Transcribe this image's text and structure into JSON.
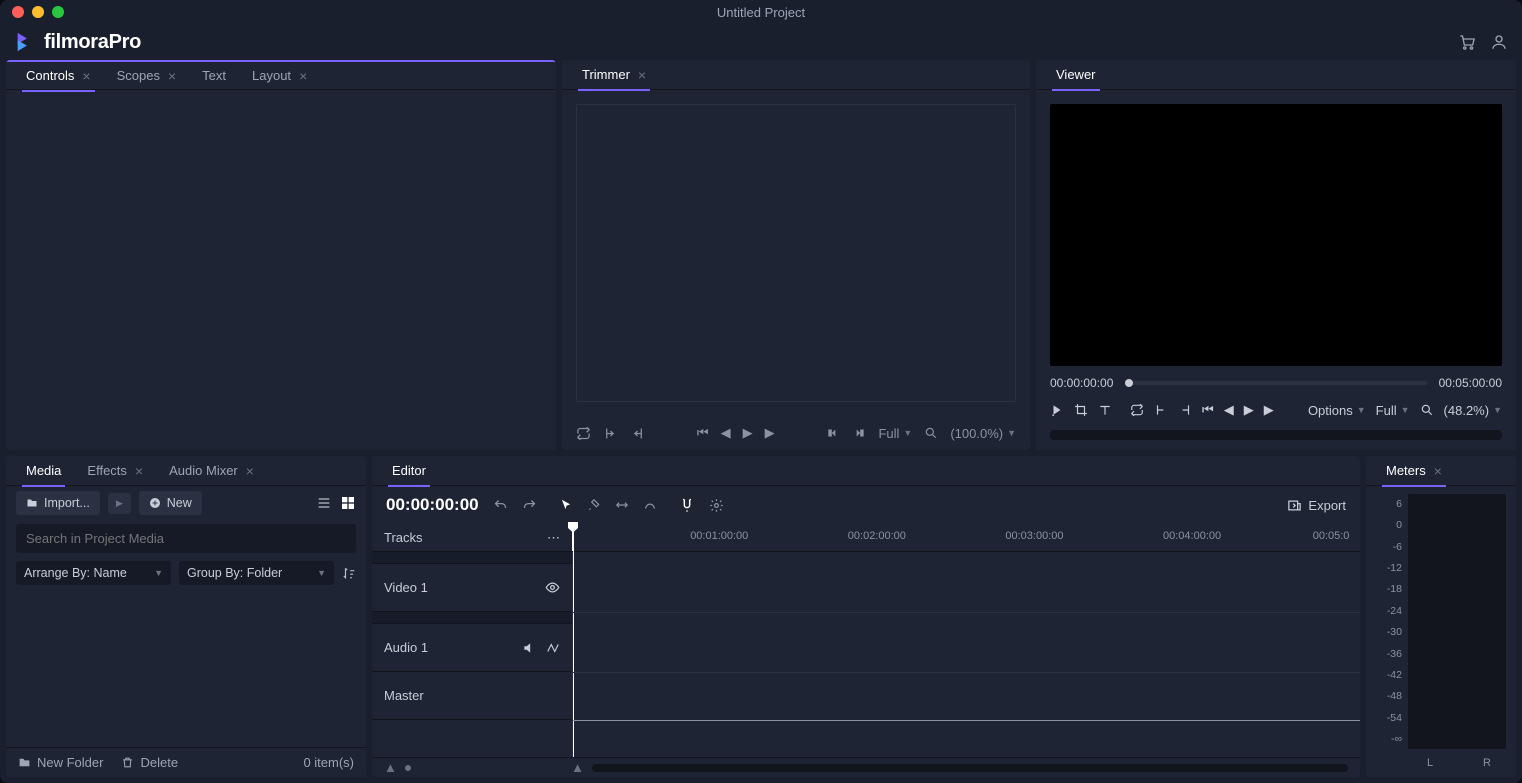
{
  "window": {
    "title": "Untitled Project"
  },
  "brand": {
    "name": "filmoraPro"
  },
  "panels": {
    "controls": {
      "tabs": [
        {
          "label": "Controls",
          "active": true,
          "closable": true
        },
        {
          "label": "Scopes",
          "active": false,
          "closable": true
        },
        {
          "label": "Text",
          "active": false,
          "closable": false
        },
        {
          "label": "Layout",
          "active": false,
          "closable": true
        }
      ]
    },
    "trimmer": {
      "tab": "Trimmer",
      "quality": "Full",
      "zoom": "(100.0%)"
    },
    "viewer": {
      "tab": "Viewer",
      "time_start": "00:00:00:00",
      "time_end": "00:05:00:00",
      "options": "Options",
      "quality": "Full",
      "zoom": "(48.2%)"
    },
    "media": {
      "tabs": [
        {
          "label": "Media",
          "active": true,
          "closable": false
        },
        {
          "label": "Effects",
          "active": false,
          "closable": true
        },
        {
          "label": "Audio Mixer",
          "active": false,
          "closable": true
        }
      ],
      "import": "Import...",
      "new": "New",
      "search_ph": "Search in Project Media",
      "arrange": "Arrange By: Name",
      "group": "Group By: Folder",
      "newfolder": "New Folder",
      "delete": "Delete",
      "count": "0 item(s)"
    },
    "editor": {
      "tab": "Editor",
      "timecode": "00:00:00:00",
      "export": "Export",
      "tracks_label": "Tracks",
      "ruler": [
        "00:01:00:00",
        "00:02:00:00",
        "00:03:00:00",
        "00:04:00:00",
        "00:05:0"
      ],
      "tracks": [
        {
          "name": "Video 1",
          "type": "video"
        },
        {
          "name": "Audio 1",
          "type": "audio"
        },
        {
          "name": "Master",
          "type": "master"
        }
      ]
    },
    "meters": {
      "tab": "Meters",
      "scale": [
        "6",
        "0",
        "-6",
        "-12",
        "-18",
        "-24",
        "-30",
        "-36",
        "-42",
        "-48",
        "-54",
        "-∞"
      ],
      "L": "L",
      "R": "R"
    }
  }
}
